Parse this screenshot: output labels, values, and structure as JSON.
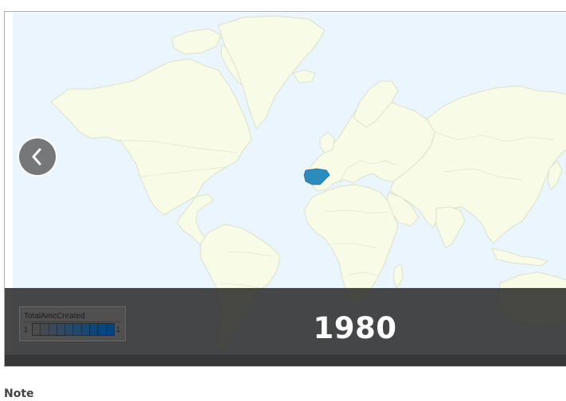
{
  "map": {
    "highlighted_country": "Spain",
    "highlight_color": "#2b8cbe",
    "land_color": "#f8fbe6",
    "ocean_color": "#eaf5fd",
    "border_color": "#d6dcc0"
  },
  "slider": {
    "caption": "1980",
    "prev_icon": "chevron-left-icon"
  },
  "legend": {
    "title": "TotalAmcCreated",
    "min_label": "1",
    "max_label": "1",
    "gradient_colors": [
      "#4b4b4b",
      "#444a52",
      "#3c4a58",
      "#33495f",
      "#2a4966",
      "#21496d",
      "#184874",
      "#10477a",
      "#08467f",
      "#02457f"
    ]
  },
  "note": {
    "heading": "Note"
  }
}
